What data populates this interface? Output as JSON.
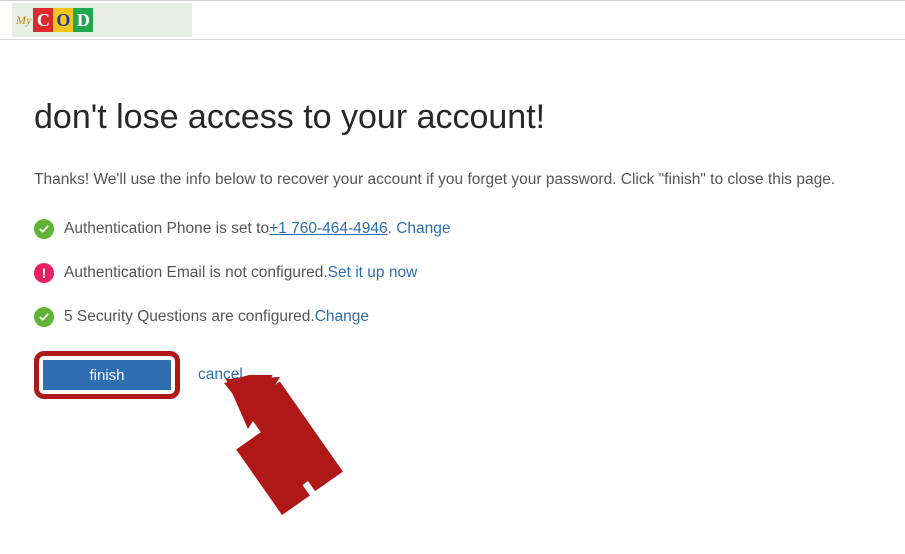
{
  "heading": "don't lose access to your account!",
  "intro_text": "Thanks! We'll use the info below to recover your account if you forget your password. Click \"finish\" to close this page.",
  "items": {
    "phone": {
      "prefix": "Authentication Phone is set to ",
      "value": "+1 760-464-4946",
      "action_label": "Change"
    },
    "email": {
      "text": "Authentication Email is not configured. ",
      "action_label": "Set it up now"
    },
    "questions": {
      "text": "5 Security Questions are configured. ",
      "action_label": "Change"
    }
  },
  "buttons": {
    "finish": "finish",
    "cancel": "cancel"
  },
  "logo": {
    "my": "My",
    "c": "C",
    "o": "O",
    "d": "D"
  }
}
